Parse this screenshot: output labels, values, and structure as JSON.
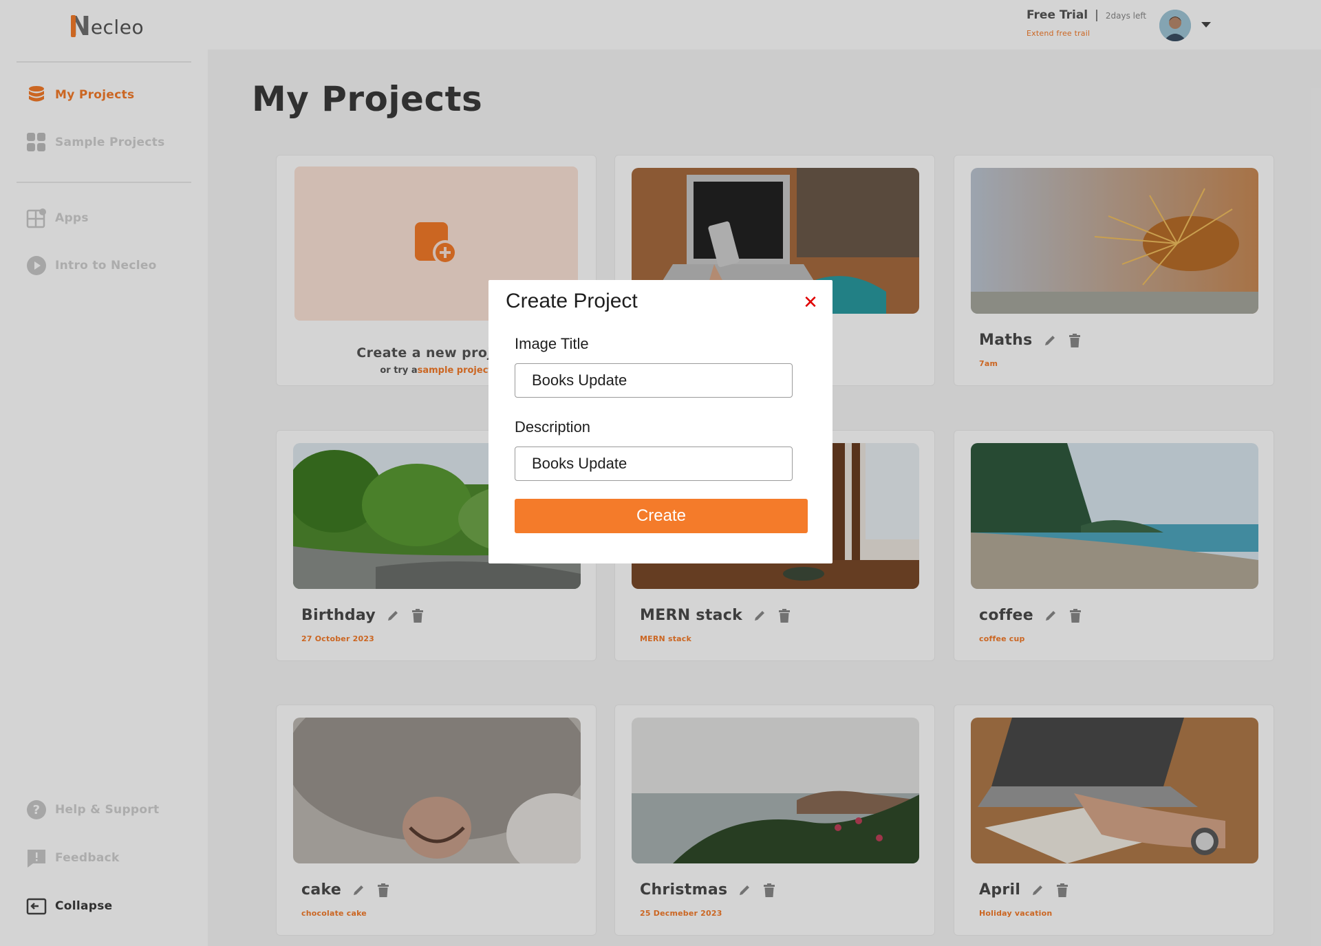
{
  "brand": {
    "logo_initial": "N",
    "logo_rest": "ecleo"
  },
  "topbar": {
    "trial_label": "Free Trial",
    "separator": "|",
    "days_left": "2days left",
    "extend_link": "Extend free trail"
  },
  "sidebar": {
    "items": [
      {
        "label": "My Projects",
        "icon": "database-icon",
        "active": true
      },
      {
        "label": "Sample Projects",
        "icon": "grid-icon",
        "active": false
      },
      {
        "label": "Apps",
        "icon": "apps-icon",
        "active": false
      },
      {
        "label": "Intro to Necleo",
        "icon": "play-icon",
        "active": false
      }
    ],
    "bottom": [
      {
        "label": "Help & Support",
        "icon": "help-icon"
      },
      {
        "label": "Feedback",
        "icon": "feedback-icon"
      },
      {
        "label": "Collapse",
        "icon": "collapse-icon"
      }
    ]
  },
  "main": {
    "title": "My Projects",
    "new_project": {
      "label": "Create a new project",
      "sub_prefix": "or try a",
      "sub_link": "sample project"
    },
    "projects": [
      {
        "name": "",
        "subtitle": "",
        "image": "laptop-phone"
      },
      {
        "name": "Maths",
        "subtitle": "7am",
        "image": "spiky-plant"
      },
      {
        "name": "Birthday",
        "subtitle": "27 October 2023",
        "image": "forest-river"
      },
      {
        "name": "MERN stack",
        "subtitle": "MERN stack",
        "image": "street-cafe"
      },
      {
        "name": "coffee",
        "subtitle": "coffee cup",
        "image": "beach-trees"
      },
      {
        "name": "cake",
        "subtitle": "chocolate cake",
        "image": "cat-nose"
      },
      {
        "name": "Christmas",
        "subtitle": "25 Decmeber 2023",
        "image": "sea-coast-flowers"
      },
      {
        "name": "April",
        "subtitle": "Holiday vacation",
        "image": "laptop-writing"
      }
    ]
  },
  "modal": {
    "title": "Create Project",
    "close": "✕",
    "image_title_label": "Image Title",
    "image_title_value": "Books Update",
    "description_label": "Description",
    "description_value": "Books Update",
    "create_button": "Create"
  },
  "colors": {
    "accent": "#f47b2a",
    "close": "#e00000",
    "overlay": "rgba(0,0,0,0.17)"
  }
}
